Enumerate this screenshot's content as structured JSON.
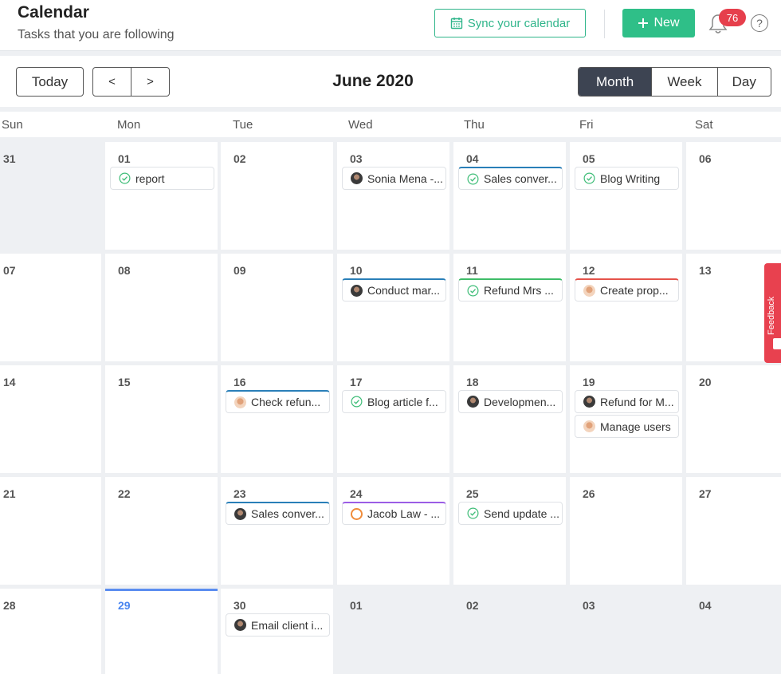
{
  "header": {
    "title": "Calendar",
    "subtitle": "Tasks that you are following",
    "sync_label": "Sync your calendar",
    "new_label": "New",
    "notification_count": "76",
    "help_label": "?"
  },
  "toolbar": {
    "today_label": "Today",
    "prev_label": "<",
    "next_label": ">",
    "month_title": "June 2020",
    "views": [
      "Month",
      "Week",
      "Day"
    ],
    "active_view": "Month"
  },
  "days_of_week": [
    "Sun",
    "Mon",
    "Tue",
    "Wed",
    "Thu",
    "Fri",
    "Sat"
  ],
  "weeks": [
    [
      {
        "date": "31",
        "other": true,
        "tasks": []
      },
      {
        "date": "01",
        "tasks": [
          {
            "title": "report",
            "icon": "check",
            "bar": ""
          }
        ]
      },
      {
        "date": "02",
        "tasks": []
      },
      {
        "date": "03",
        "tasks": [
          {
            "title": "Sonia Mena -...",
            "icon": "avatar-dark",
            "bar": ""
          }
        ]
      },
      {
        "date": "04",
        "tasks": [
          {
            "title": "Sales conver...",
            "icon": "check",
            "bar": "blue"
          }
        ]
      },
      {
        "date": "05",
        "tasks": [
          {
            "title": "Blog Writing",
            "icon": "check",
            "bar": ""
          }
        ]
      },
      {
        "date": "06",
        "tasks": []
      }
    ],
    [
      {
        "date": "07",
        "tasks": []
      },
      {
        "date": "08",
        "tasks": []
      },
      {
        "date": "09",
        "tasks": []
      },
      {
        "date": "10",
        "tasks": [
          {
            "title": "Conduct mar...",
            "icon": "avatar-dark",
            "bar": "blue"
          }
        ]
      },
      {
        "date": "11",
        "tasks": [
          {
            "title": "Refund Mrs ...",
            "icon": "check",
            "bar": "green"
          }
        ]
      },
      {
        "date": "12",
        "tasks": [
          {
            "title": "Create prop...",
            "icon": "avatar-skin",
            "bar": "red"
          }
        ]
      },
      {
        "date": "13",
        "tasks": []
      }
    ],
    [
      {
        "date": "14",
        "tasks": []
      },
      {
        "date": "15",
        "tasks": []
      },
      {
        "date": "16",
        "tasks": [
          {
            "title": "Check refun...",
            "icon": "avatar-skin",
            "bar": "blue"
          }
        ]
      },
      {
        "date": "17",
        "tasks": [
          {
            "title": "Blog article f...",
            "icon": "check",
            "bar": ""
          }
        ]
      },
      {
        "date": "18",
        "tasks": [
          {
            "title": "Developmen...",
            "icon": "avatar-dark",
            "bar": ""
          }
        ]
      },
      {
        "date": "19",
        "tasks": [
          {
            "title": "Refund for M...",
            "icon": "avatar-dark",
            "bar": ""
          },
          {
            "title": "Manage users",
            "icon": "avatar-skin",
            "bar": ""
          }
        ]
      },
      {
        "date": "20",
        "tasks": []
      }
    ],
    [
      {
        "date": "21",
        "tasks": []
      },
      {
        "date": "22",
        "tasks": []
      },
      {
        "date": "23",
        "tasks": [
          {
            "title": "Sales conver...",
            "icon": "avatar-dark",
            "bar": "blue"
          }
        ]
      },
      {
        "date": "24",
        "tasks": [
          {
            "title": "Jacob Law - ...",
            "icon": "avatar-orange",
            "bar": "purple"
          }
        ]
      },
      {
        "date": "25",
        "tasks": [
          {
            "title": "Send update ...",
            "icon": "check",
            "bar": ""
          }
        ]
      },
      {
        "date": "26",
        "tasks": []
      },
      {
        "date": "27",
        "tasks": []
      }
    ],
    [
      {
        "date": "28",
        "tasks": []
      },
      {
        "date": "29",
        "today": true,
        "tasks": []
      },
      {
        "date": "30",
        "tasks": [
          {
            "title": "Email client i...",
            "icon": "avatar-dark",
            "bar": ""
          }
        ]
      },
      {
        "date": "01",
        "other": true,
        "tasks": []
      },
      {
        "date": "02",
        "other": true,
        "tasks": []
      },
      {
        "date": "03",
        "other": true,
        "tasks": []
      },
      {
        "date": "04",
        "other": true,
        "tasks": []
      }
    ]
  ],
  "feedback_label": "Feedback",
  "colors": {
    "accent_green": "#2fbf88",
    "badge_red": "#e63f4c",
    "today_blue": "#4a86f0",
    "active_view": "#3d4452"
  }
}
